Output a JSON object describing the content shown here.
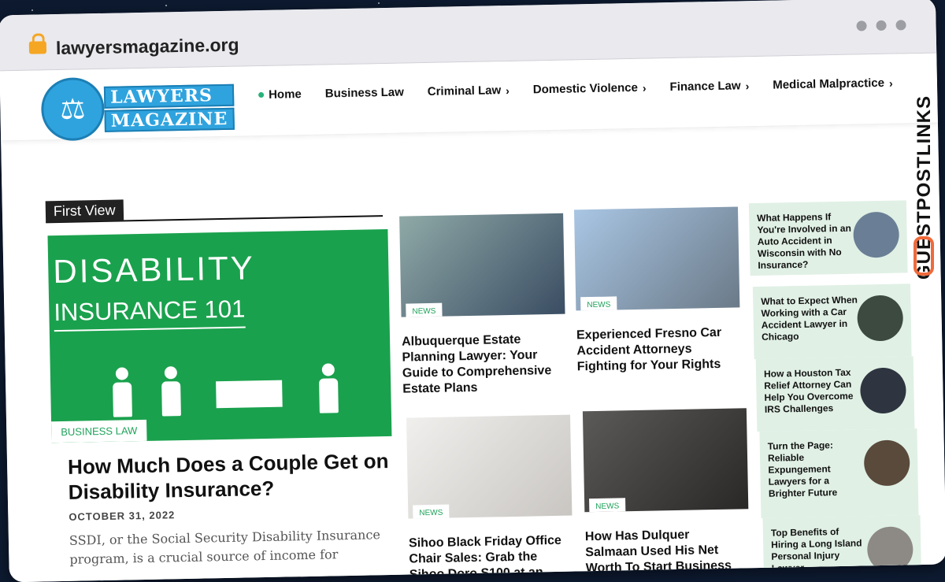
{
  "browser": {
    "url": "lawyersmagazine.org"
  },
  "site": {
    "logo_line1": "LAWYERS",
    "logo_line2": "MAGAZINE",
    "nav": [
      "Home",
      "Business Law",
      "Criminal Law",
      "Domestic Violence",
      "Finance Law",
      "Medical Malpractice"
    ]
  },
  "section_label": "First View",
  "hero": {
    "image_text_1": "DISABILITY",
    "image_text_2": "INSURANCE 101",
    "category": "BUSINESS LAW",
    "title": "How Much Does a Couple Get on Disability Insurance?",
    "date": "OCTOBER 31, 2022",
    "excerpt": "SSDI, or the Social Security Disability Insurance program, is a crucial source of income for"
  },
  "cards": [
    {
      "tag": "NEWS",
      "title": "Albuquerque Estate Planning Lawyer: Your Guide to Comprehensive Estate Plans"
    },
    {
      "tag": "NEWS",
      "title": "Experienced Fresno Car Accident Attorneys Fighting for Your Rights"
    },
    {
      "tag": "NEWS",
      "title": "Sihoo Black Friday Office Chair Sales: Grab the Sihoo Doro S100 at an Unbeatable Price!"
    },
    {
      "tag": "NEWS",
      "title": "How Has Dulquer Salmaan Used His Net Worth To Start Business Ventures?"
    }
  ],
  "sidebar": [
    "What Happens If You're Involved in an Auto Accident in Wisconsin with No Insurance?",
    "What to Expect When Working with a Car Accident Lawyer in Chicago",
    "How a Houston Tax Relief Attorney Can Help You Overcome IRS Challenges",
    "Turn the Page: Reliable Expungement Lawyers for a Brighter Future",
    "Top Benefits of Hiring a Long Island Personal Injury Lawyer"
  ],
  "watermark": "GUESTPOSTLINKS"
}
